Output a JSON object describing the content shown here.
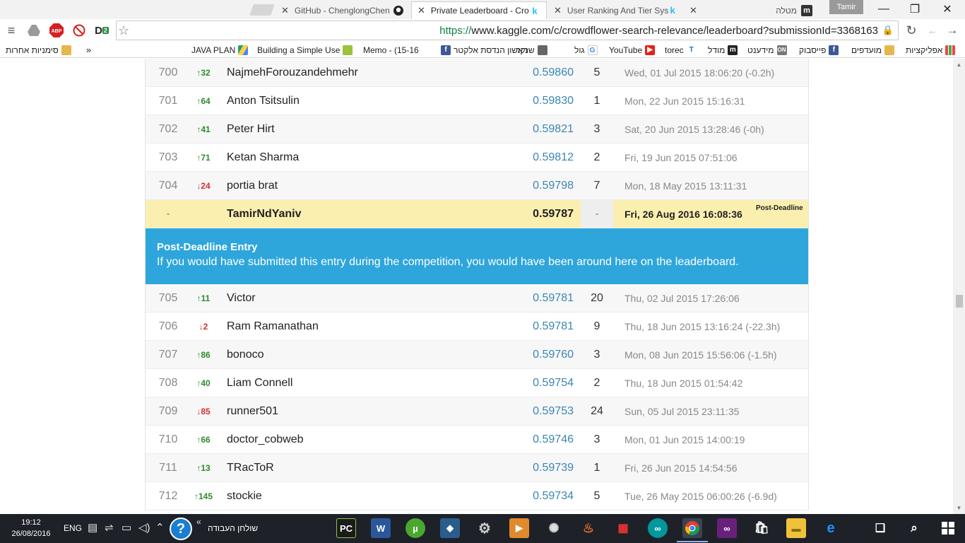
{
  "browser": {
    "tabs": [
      {
        "title": "GitHub - ChenglongChen",
        "favicon": "github-icon",
        "active": false
      },
      {
        "title": "Private Leaderboard - Cro",
        "favicon": "kaggle-icon",
        "active": true
      },
      {
        "title": "User Ranking And Tier Sys",
        "favicon": "kaggle-icon",
        "active": false
      },
      {
        "title": "מטלה",
        "favicon": "moodle-icon",
        "active": false
      }
    ],
    "profile_name": "Tamir",
    "url_scheme": "https://",
    "url_rest": "www.kaggle.com/c/crowdflower-search-relevance/leaderboard?submissionId=3368163"
  },
  "bookmarks": {
    "other_bookmarks": "סימניות אחרות",
    "overflow": "»",
    "items": [
      {
        "label": "JAVA PLAN",
        "icon": "drive-icon"
      },
      {
        "label": "Building a Simple Use",
        "icon": "android-icon"
      },
      {
        "label": "Memo - (15-16",
        "icon": "facebook-icon"
      },
      {
        "label": "ראשון הנדסת אלקטר",
        "icon": "folder-icon"
      },
      {
        "label": "שנקר",
        "icon": "shenkar-icon"
      },
      {
        "label": "גול",
        "icon": "google-icon"
      },
      {
        "label": "YouTube",
        "icon": "youtube-icon"
      },
      {
        "label": "torec",
        "icon": "torec-icon"
      },
      {
        "label": "מודל",
        "icon": "moodle-icon"
      },
      {
        "label": "מידענט",
        "icon": "midanet-icon"
      },
      {
        "label": "פייסבוק",
        "icon": "facebook-icon"
      },
      {
        "label": "מועדפים",
        "icon": "folder-icon"
      },
      {
        "label": "אפליקציות",
        "icon": "apps-grid-icon"
      }
    ]
  },
  "leaderboard": {
    "rows_before": [
      {
        "rank": "700",
        "delta": "32",
        "dir": "up",
        "team": "NajmehForouzandehmehr",
        "score": "0.59860",
        "entries": "5",
        "last": "Wed, 01 Jul 2015 18:06:20 (-0.2h)"
      },
      {
        "rank": "701",
        "delta": "64",
        "dir": "up",
        "team": "Anton Tsitsulin",
        "score": "0.59830",
        "entries": "1",
        "last": "Mon, 22 Jun 2015 15:16:31"
      },
      {
        "rank": "702",
        "delta": "41",
        "dir": "up",
        "team": "Peter Hirt",
        "score": "0.59821",
        "entries": "3",
        "last": "Sat, 20 Jun 2015 13:28:46 (-0h)"
      },
      {
        "rank": "703",
        "delta": "71",
        "dir": "up",
        "team": "Ketan Sharma",
        "score": "0.59812",
        "entries": "2",
        "last": "Fri, 19 Jun 2015 07:51:06"
      },
      {
        "rank": "704",
        "delta": "24",
        "dir": "down",
        "team": "portia brat",
        "score": "0.59798",
        "entries": "7",
        "last": "Mon, 18 May 2015 13:11:31"
      }
    ],
    "user_entry": {
      "rank": "-",
      "team": "TamirNdYaniv",
      "score": "0.59787",
      "entries": "-",
      "last": "Fri, 26 Aug 2016 16:08:36",
      "tag": "Post-Deadline"
    },
    "banner": {
      "title": "Post-Deadline Entry",
      "text": "If you would have submitted this entry during the competition, you would have been around here on the leaderboard."
    },
    "rows_after": [
      {
        "rank": "705",
        "delta": "11",
        "dir": "up",
        "team": "Victor",
        "score": "0.59781",
        "entries": "20",
        "last": "Thu, 02 Jul 2015 17:26:06"
      },
      {
        "rank": "706",
        "delta": "2",
        "dir": "down",
        "team": "Ram Ramanathan",
        "score": "0.59781",
        "entries": "9",
        "last": "Thu, 18 Jun 2015 13:16:24 (-22.3h)"
      },
      {
        "rank": "707",
        "delta": "86",
        "dir": "up",
        "team": "bonoco",
        "score": "0.59760",
        "entries": "3",
        "last": "Mon, 08 Jun 2015 15:56:06 (-1.5h)"
      },
      {
        "rank": "708",
        "delta": "40",
        "dir": "up",
        "team": "Liam Connell",
        "score": "0.59754",
        "entries": "2",
        "last": "Thu, 18 Jun 2015 01:54:42"
      },
      {
        "rank": "709",
        "delta": "85",
        "dir": "down",
        "team": "runner501",
        "score": "0.59753",
        "entries": "24",
        "last": "Sun, 05 Jul 2015 23:11:35"
      },
      {
        "rank": "710",
        "delta": "66",
        "dir": "up",
        "team": "doctor_cobweb",
        "score": "0.59746",
        "entries": "3",
        "last": "Mon, 01 Jun 2015 14:00:19"
      },
      {
        "rank": "711",
        "delta": "13",
        "dir": "up",
        "team": "TRacToR",
        "score": "0.59739",
        "entries": "1",
        "last": "Fri, 26 Jun 2015 14:54:56"
      },
      {
        "rank": "712",
        "delta": "145",
        "dir": "up",
        "team": "stockie",
        "score": "0.59734",
        "entries": "5",
        "last": "Tue, 26 May 2015 06:00:26 (-6.9d)"
      }
    ],
    "colors": {
      "up": "#2f8a2f",
      "down": "#d03030",
      "score": "#3a86b4",
      "highlight": "#fbefb0",
      "banner": "#2ea6dc"
    }
  },
  "taskbar": {
    "time": "19:12",
    "date": "26/08/2016",
    "language": "ENG",
    "desktop_label": "שולחן העבודה",
    "help_label": "?"
  }
}
